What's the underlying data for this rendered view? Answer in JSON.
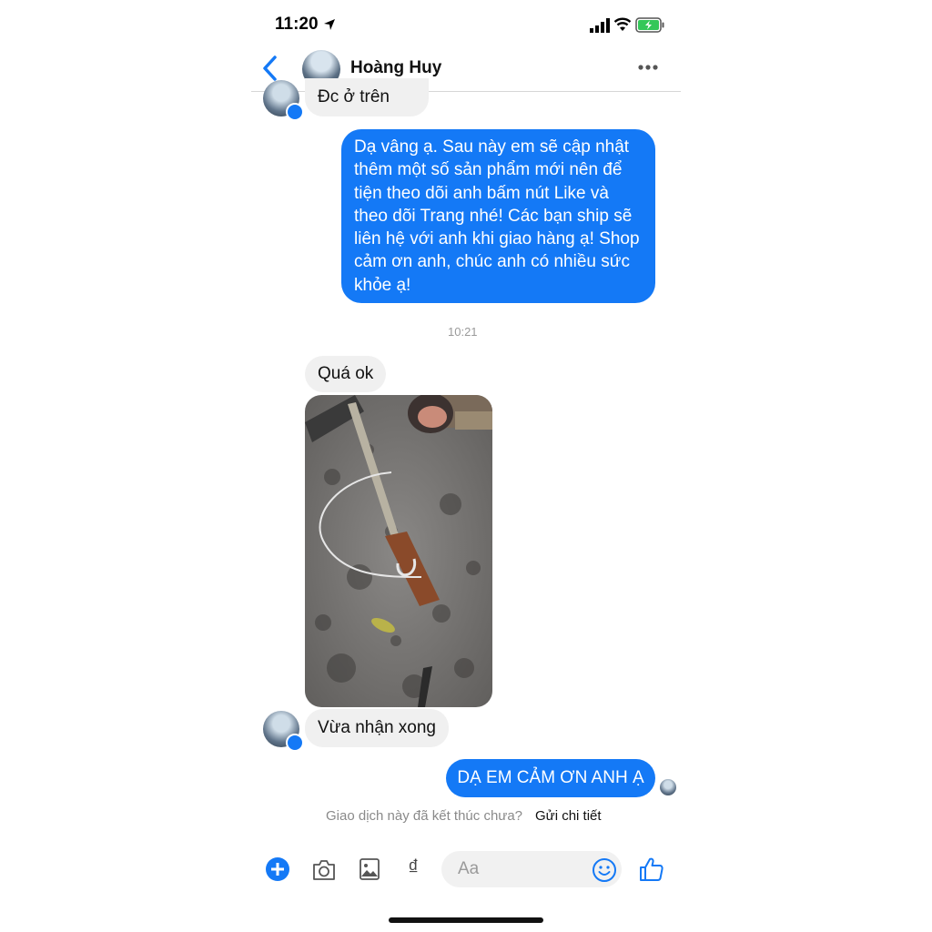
{
  "status_bar": {
    "time": "11:20"
  },
  "header": {
    "contact_name": "Hoàng Huy"
  },
  "messages": {
    "top_partial": "Đc ở trên",
    "long_reply": "Dạ vâng ạ. Sau này em sẽ cập nhật thêm một số sản phẩm mới nên để tiện theo dõi anh bấm nút  Like và theo dõi Trang nhé! Các bạn ship sẽ liên hệ với anh khi giao hàng ạ! Shop cảm ơn anh, chúc anh có nhiều sức khỏe ạ!",
    "timestamp": "10:21",
    "quick_ok": "Quá ok",
    "received": "Vừa nhận xong",
    "thanks": "DẠ EM CẢM ƠN ANH Ạ"
  },
  "transaction": {
    "question": "Giao dịch này đã kết thúc chưa?",
    "details_link": "Gửi chi tiết"
  },
  "composer": {
    "placeholder": "Aa",
    "currency_symbol": "₫"
  },
  "colors": {
    "accent": "#1479f6",
    "incoming_bubble": "#f0f0f0"
  },
  "icons": [
    "location-arrow-icon",
    "signal-icon",
    "wifi-icon",
    "battery-icon",
    "back-chevron-icon",
    "more-icon",
    "messenger-badge-icon",
    "plus-icon",
    "camera-icon",
    "image-icon",
    "smiley-icon",
    "like-icon"
  ]
}
